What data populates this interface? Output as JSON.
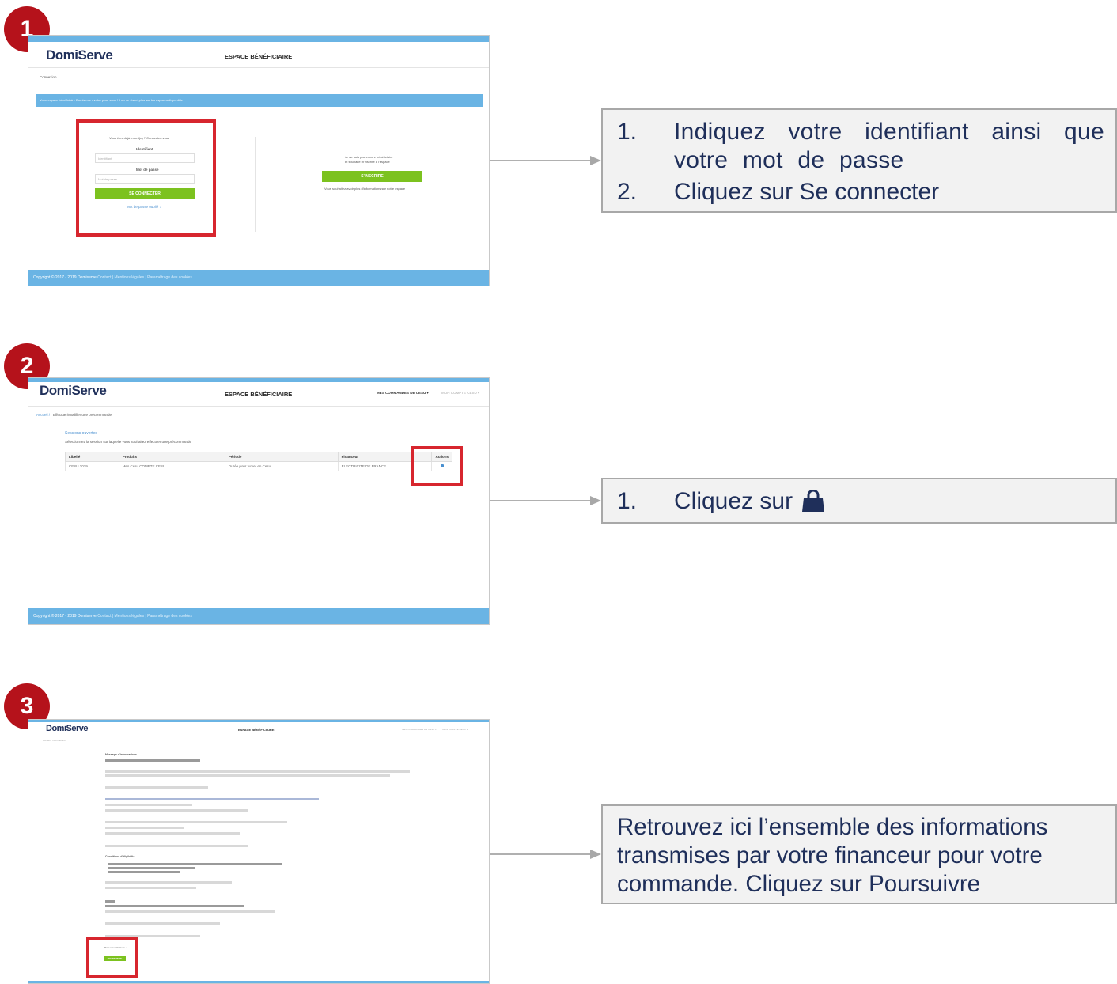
{
  "brand": {
    "logo": "DomiServe",
    "espace": "ESPACE BÉNÉFICIAIRE",
    "accent": "#6ab4e4",
    "green": "#7cc21f",
    "badge_red": "#b5121b",
    "highlight_red": "#d7262e",
    "text_navy": "#1f2f5a"
  },
  "steps": [
    {
      "num": "1"
    },
    {
      "num": "2"
    },
    {
      "num": "3"
    }
  ],
  "step1": {
    "breadcrumb": "Connexion",
    "banner": "Votre espace bénéficiaire Domiserve évolue pour vous ! Il ou ne visuel plus sur les espaces disponible",
    "login_prompt": "Vous êtes déjà inscrit(e) ? Connectez-vous",
    "identifiant_label": "Identifiant",
    "identifiant_placeholder": "Identifiant",
    "password_label": "Mot de passe",
    "password_placeholder": "Mot de passe",
    "connect_btn": "SE CONNECTER",
    "forgot": "Mot de passe oublié ?",
    "register_text_1": "Je ne suis pas encore bénéficiaire",
    "register_text_2": "et souhaite m'inscrire à l'espace",
    "register_btn": "S'INSCRIRE",
    "more_info": "Vous souhaitez avoir plus d'informations sur notre espace",
    "footer_copy": "Copyright © 2017 - 2019 Domiserve",
    "footer_links": "Contact | Mentions légales | Paramétrage des cookies"
  },
  "step2": {
    "nav_orders": "MES COMMANDES DE CESU ▾",
    "nav_account": "MON COMPTE CESU ▾",
    "breadcrumb_home": "Accueil /",
    "breadcrumb_page": "Effectuer/Modifier une précommande",
    "sessions_title": "Sessions ouvertes",
    "sessions_desc": "Sélectionnez la session sur laquelle vous souhaitez effectuer une précommande",
    "table_headers": [
      "Libellé",
      "Produits",
      "Période",
      "Financeur",
      "Actions"
    ],
    "table_row": [
      "CESU 2019",
      "Mes Cesu COMPTE CESU",
      "Durée pour fumer en Cesu",
      "ELECTRICITE DE FRANCE"
    ],
    "footer_copy": "Copyright © 2017 - 2019 Domiserve",
    "footer_links": "Contact | Mentions légales | Paramétrage des cookies"
  },
  "step3": {
    "nav_orders": "MES COMMANDES DE CESU ▾",
    "nav_account": "MON COMPTE CESU ▾",
    "breadcrumb": "Accueil / Informations",
    "section_title": "Message d'informations",
    "conditions_title": "Conditions d'éligibilité",
    "continue_label": "Pour nouvelle Cesu :",
    "continue_btn": "POURSUIVRE"
  },
  "instructions": {
    "box1": [
      {
        "num": "1.",
        "text": "Indiquez votre identifiant ainsi que votre mot de passe"
      },
      {
        "num": "2.",
        "text": "Cliquez sur Se connecter"
      }
    ],
    "box2": [
      {
        "num": "1.",
        "text": "Cliquez sur",
        "icon": "shopping-bag-icon"
      }
    ],
    "box3": "Retrouvez ici l’ensemble des informations transmises par votre financeur pour votre commande. Cliquez sur Poursuivre"
  }
}
